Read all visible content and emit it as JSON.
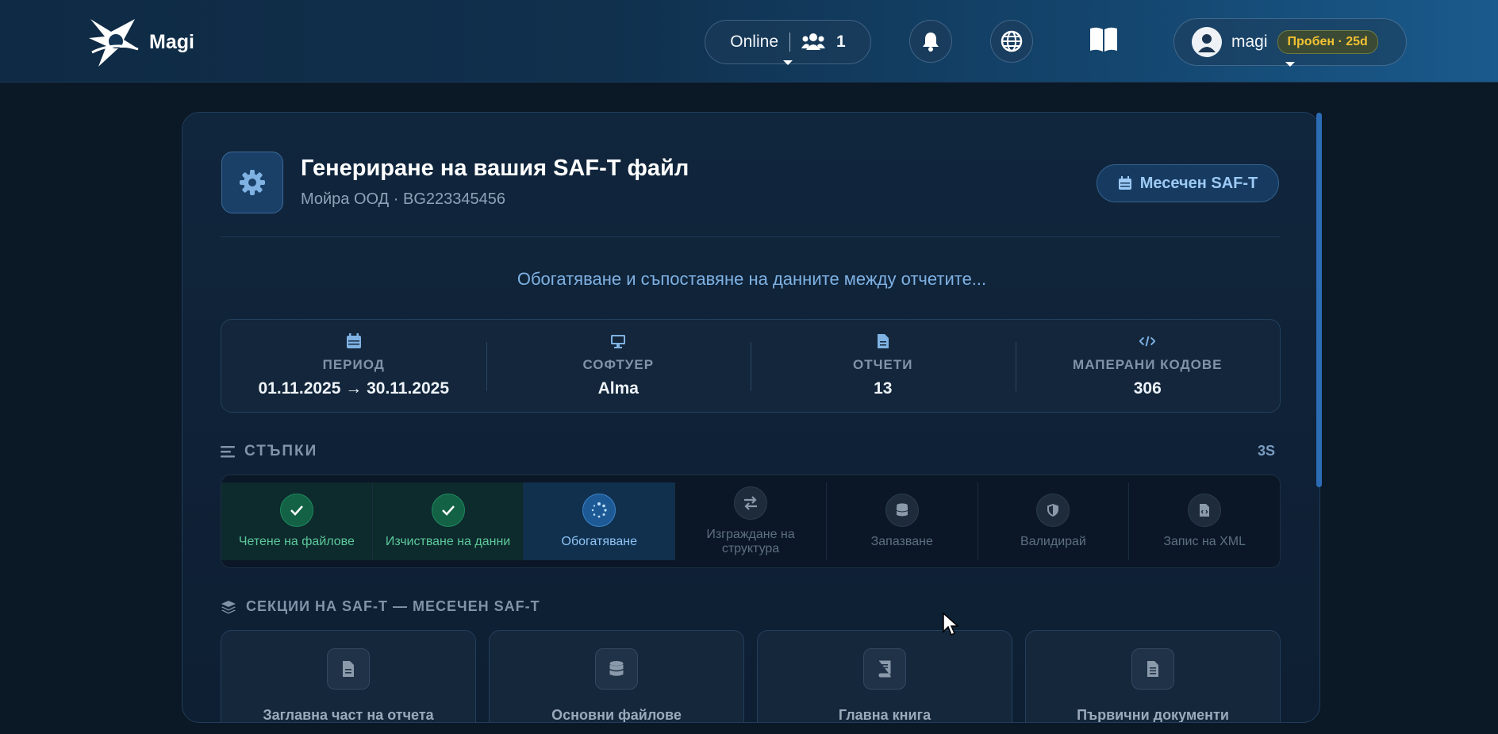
{
  "app": {
    "name": "Magi"
  },
  "header": {
    "online_label": "Online",
    "online_count": "1",
    "username": "magi",
    "trial_badge": "Пробен · 25d"
  },
  "card": {
    "title": "Генериране на вашия SAF-T файл",
    "subtitle": "Мойра ООД · BG223345456",
    "type_button": "Месечен SAF-T",
    "status_text": "Обогатяване и съпоставяне на данните между отчетите..."
  },
  "stats": [
    {
      "icon": "calendar-icon",
      "label": "ПЕРИОД",
      "value": "01.11.2025 → 30.11.2025"
    },
    {
      "icon": "monitor-icon",
      "label": "СОФТУЕР",
      "value": "Alma"
    },
    {
      "icon": "document-icon",
      "label": "ОТЧЕТИ",
      "value": "13"
    },
    {
      "icon": "code-icon",
      "label": "МАПЕРАНИ КОДОВЕ",
      "value": "306"
    }
  ],
  "steps_section": {
    "title": "СТЪПКИ",
    "elapsed": "3S",
    "steps": [
      {
        "label": "Четене на файлове",
        "state": "done",
        "icon": "check-icon"
      },
      {
        "label": "Изчистване на данни",
        "state": "done",
        "icon": "check-icon"
      },
      {
        "label": "Обогатяване",
        "state": "active",
        "icon": "spinner-icon"
      },
      {
        "label": "Изграждане на структура",
        "state": "pending",
        "icon": "exchange-icon"
      },
      {
        "label": "Запазване",
        "state": "pending",
        "icon": "database-icon"
      },
      {
        "label": "Валидирай",
        "state": "pending",
        "icon": "shield-icon"
      },
      {
        "label": "Запис на XML",
        "state": "pending",
        "icon": "file-code-icon"
      }
    ]
  },
  "sections_section": {
    "title": "СЕКЦИИ НА SAF-T — МЕСЕЧЕН SAF-T",
    "items": [
      {
        "label": "Заглавна част на отчета",
        "icon": "file-icon"
      },
      {
        "label": "Основни файлове",
        "icon": "database-icon"
      },
      {
        "label": "Главна книга",
        "icon": "book-icon"
      },
      {
        "label": "Първични документи",
        "icon": "file-lines-icon"
      }
    ]
  },
  "colors": {
    "accent": "#7fb2e3",
    "done": "#5cc99a",
    "trial_text": "#f1c232"
  }
}
